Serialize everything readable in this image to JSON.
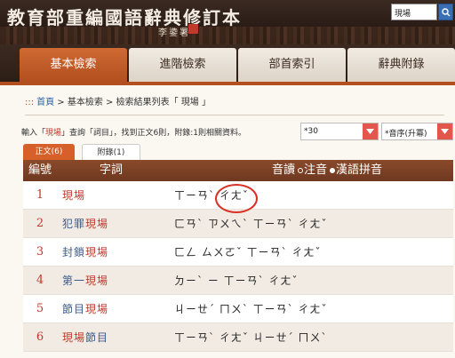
{
  "header": {
    "site_title": "教育部重編國語辭典修訂本",
    "calligrapher": "李鍌署",
    "search_value": "現場"
  },
  "nav": {
    "tabs": [
      {
        "label": "基本檢索",
        "active": true
      },
      {
        "label": "進階檢索",
        "active": false
      },
      {
        "label": "部首索引",
        "active": false
      },
      {
        "label": "辭典附錄",
        "active": false
      }
    ]
  },
  "breadcrumb": {
    "marker": ":::",
    "home": "首頁",
    "sep1": " > ",
    "basic": "基本檢索",
    "sep2": " > ",
    "results": "檢索結果列表「 現場 」"
  },
  "summary": {
    "pre": "輸入「",
    "keyword": "現場",
    "mid": "」查詢「詞目」，找到正文6則，附錄:1則相關資料。"
  },
  "controls": {
    "per_page": "*30",
    "sort": "*音序(升冪)"
  },
  "subtabs": {
    "main": "正文(6)",
    "appendix": "附錄(1)"
  },
  "table": {
    "headers": {
      "num": "編號",
      "word": "字詞",
      "sound": "音讀",
      "opt_zhuyin": "注音",
      "opt_pinyin": "漢語拼音"
    },
    "rows": [
      {
        "num": "1",
        "pre": "",
        "hl": "現場",
        "post": "",
        "zhuyin": "ㄒㄧㄢˋ  ㄔㄤˇ"
      },
      {
        "num": "2",
        "pre": "犯罪",
        "hl": "現場",
        "post": "",
        "zhuyin": "ㄈㄢˋ  ㄗㄨㄟˋ  ㄒㄧㄢˋ  ㄔㄤˇ"
      },
      {
        "num": "3",
        "pre": "封鎖",
        "hl": "現場",
        "post": "",
        "zhuyin": "ㄈㄥ  ㄙㄨㄛˇ  ㄒㄧㄢˋ  ㄔㄤˇ"
      },
      {
        "num": "4",
        "pre": "第一",
        "hl": "現場",
        "post": "",
        "zhuyin": "ㄉㄧˋ  ㄧ  ㄒㄧㄢˋ  ㄔㄤˇ"
      },
      {
        "num": "5",
        "pre": "節目",
        "hl": "現場",
        "post": "",
        "zhuyin": "ㄐㄧㄝˊ  ㄇㄨˋ  ㄒㄧㄢˋ  ㄔㄤˇ"
      },
      {
        "num": "6",
        "pre": "",
        "hl": "現場",
        "post": "節目",
        "zhuyin": "ㄒㄧㄢˋ  ㄔㄤˇ  ㄐㄧㄝˊ  ㄇㄨˋ"
      }
    ]
  },
  "colors": {
    "accent": "#b34f1e",
    "header_bg": "#2a1c16",
    "highlight": "#c0392b",
    "annotation": "#d93025"
  }
}
